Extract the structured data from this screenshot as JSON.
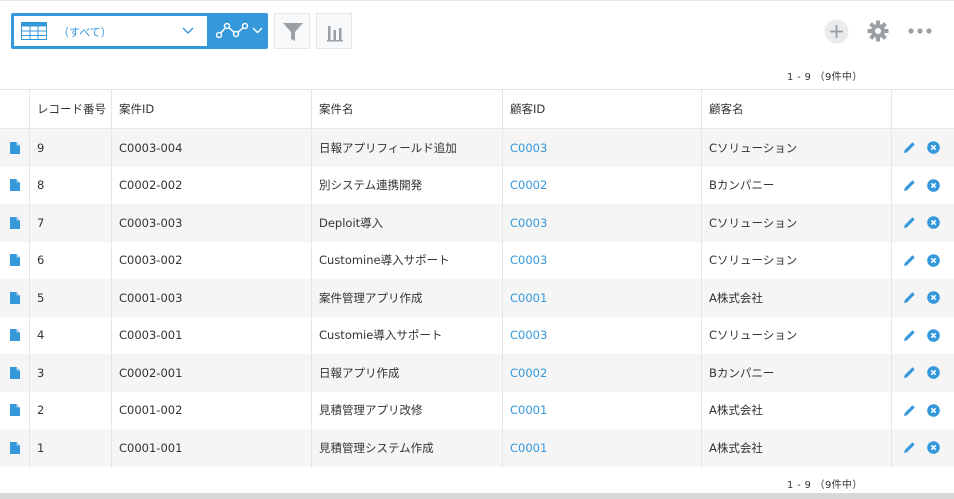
{
  "toolbar": {
    "view_label": "（すべて）",
    "pagination_top": "1 - 9 （9件中）"
  },
  "columns": [
    "レコード番号",
    "案件ID",
    "案件名",
    "顧客ID",
    "顧客名"
  ],
  "rows": [
    {
      "record_no": "9",
      "case_id": "C0003-004",
      "case_name": "日報アプリフィールド追加",
      "customer_id": "C0003",
      "customer_name": "Cソリューション"
    },
    {
      "record_no": "8",
      "case_id": "C0002-002",
      "case_name": "別システム連携開発",
      "customer_id": "C0002",
      "customer_name": "Bカンパニー"
    },
    {
      "record_no": "7",
      "case_id": "C0003-003",
      "case_name": "Deploit導入",
      "customer_id": "C0003",
      "customer_name": "Cソリューション"
    },
    {
      "record_no": "6",
      "case_id": "C0003-002",
      "case_name": "Customine導入サポート",
      "customer_id": "C0003",
      "customer_name": "Cソリューション"
    },
    {
      "record_no": "5",
      "case_id": "C0001-003",
      "case_name": "案件管理アプリ作成",
      "customer_id": "C0001",
      "customer_name": "A株式会社"
    },
    {
      "record_no": "4",
      "case_id": "C0003-001",
      "case_name": "Customie導入サポート",
      "customer_id": "C0003",
      "customer_name": "Cソリューション"
    },
    {
      "record_no": "3",
      "case_id": "C0002-001",
      "case_name": "日報アプリ作成",
      "customer_id": "C0002",
      "customer_name": "Bカンパニー"
    },
    {
      "record_no": "2",
      "case_id": "C0001-002",
      "case_name": "見積管理アプリ改修",
      "customer_id": "C0001",
      "customer_name": "A株式会社"
    },
    {
      "record_no": "1",
      "case_id": "C0001-001",
      "case_name": "見積管理システム作成",
      "customer_id": "C0001",
      "customer_name": "A株式会社"
    }
  ],
  "footer": {
    "pagination_bottom": "1 - 9 （9件中）"
  },
  "colors": {
    "accent": "#3498db",
    "row_alt": "#f5f5f5",
    "border": "#e3e7e8"
  },
  "icons": {
    "view": "table-icon",
    "graph": "graph-icon",
    "filter": "filter-icon",
    "chart": "bar-chart-icon",
    "add": "plus-circle-icon",
    "settings": "gear-icon",
    "more": "more-dots-icon",
    "record": "document-icon",
    "edit": "pencil-icon",
    "delete": "close-circle-icon"
  }
}
